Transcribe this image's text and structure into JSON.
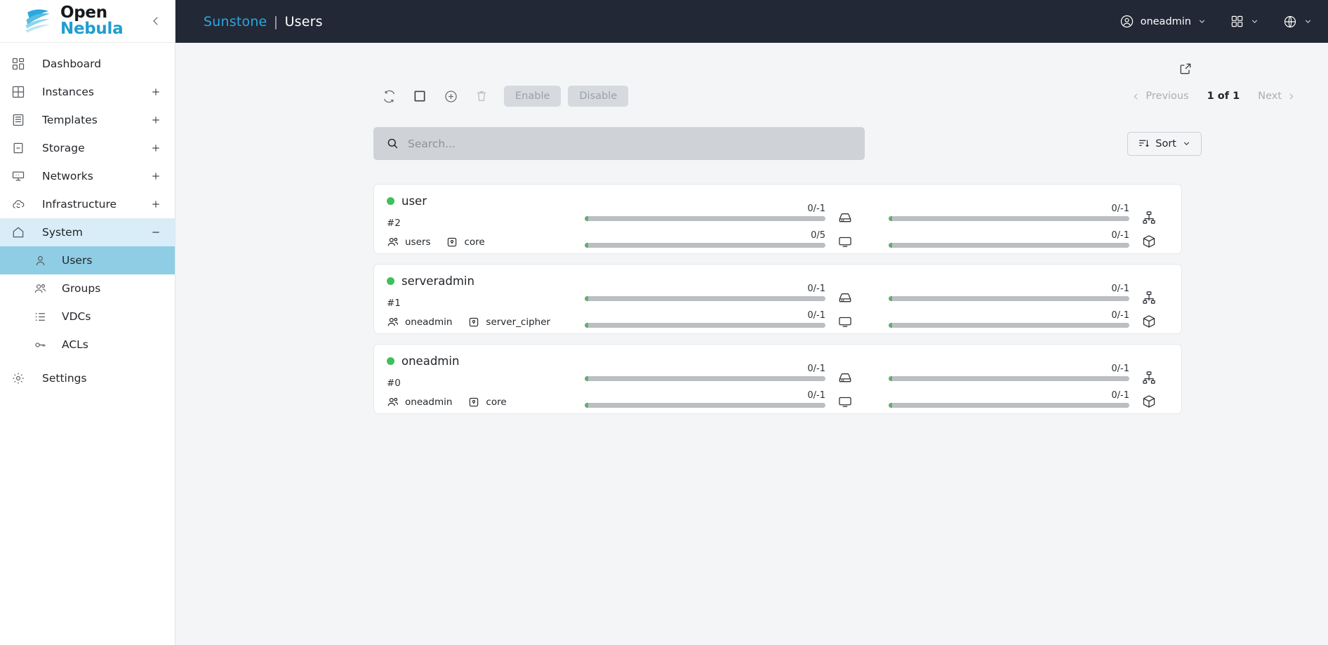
{
  "brand": {
    "line1": "Open",
    "line2": "Nebula",
    "logo_color": "#1f9ed0",
    "collapse_icon": "chevron-left-icon"
  },
  "header": {
    "app_name": "Sunstone",
    "separator": "|",
    "section": "Users",
    "accent_color": "#2aa8e0",
    "background": "#232836",
    "user": {
      "label": "oneadmin",
      "icon": "user-circle-icon"
    },
    "apps": {
      "icon": "grid-apps-icon"
    },
    "language": {
      "icon": "globe-icon"
    }
  },
  "sidebar": {
    "items": [
      {
        "label": "Dashboard",
        "icon": "dashboard-icon",
        "has_plus": false
      },
      {
        "label": "Instances",
        "icon": "instances-grid-icon",
        "has_plus": true
      },
      {
        "label": "Templates",
        "icon": "templates-drawer-icon",
        "has_plus": true
      },
      {
        "label": "Storage",
        "icon": "storage-icon",
        "has_plus": true
      },
      {
        "label": "Networks",
        "icon": "network-monitor-icon",
        "has_plus": true
      },
      {
        "label": "Infrastructure",
        "icon": "cloud-infrastructure-icon",
        "has_plus": true
      },
      {
        "label": "System",
        "icon": "home-icon",
        "has_plus": true,
        "expanded": true,
        "collapse_sign": "−"
      }
    ],
    "system_children": [
      {
        "label": "Users",
        "icon": "user-icon",
        "active": true
      },
      {
        "label": "Groups",
        "icon": "users-group-icon",
        "active": false
      },
      {
        "label": "VDCs",
        "icon": "list-icon",
        "active": false
      },
      {
        "label": "ACLs",
        "icon": "key-icon",
        "active": false
      }
    ],
    "settings": {
      "label": "Settings",
      "icon": "gear-icon"
    },
    "active_bg": "#8ecde4",
    "expanded_bg": "#d8edf7"
  },
  "toolbar": {
    "refresh_icon": "refresh-icon",
    "select_all_icon": "checkbox-square-icon",
    "add_icon": "plus-circle-icon",
    "delete_icon": "trash-icon",
    "enable_label": "Enable",
    "disable_label": "Disable",
    "export_icon": "external-link-icon"
  },
  "pagination": {
    "previous_label": "Previous",
    "next_label": "Next",
    "count_label": "1 of 1",
    "prev_icon": "chevron-left-icon",
    "next_icon": "chevron-right-icon"
  },
  "search": {
    "placeholder": "Search...",
    "value": "",
    "icon": "search-icon"
  },
  "sort": {
    "label": "Sort",
    "icon": "sort-icon",
    "chevron": "chevron-down-icon"
  },
  "quota_icons": {
    "datastore": "datastore-icon",
    "vm": "vm-monitor-icon",
    "network": "network-nodes-icon",
    "image": "image-box-icon"
  },
  "users": [
    {
      "name": "user",
      "id_label": "#2",
      "state_color": "#3fc158",
      "group": "users",
      "group_icon": "users-group-icon",
      "auth": "core",
      "auth_icon": "lock-icon",
      "quotas": {
        "datastore": "0/-1",
        "vm": "0/5",
        "network": "0/-1",
        "image": "0/-1"
      }
    },
    {
      "name": "serveradmin",
      "id_label": "#1",
      "state_color": "#3fc158",
      "group": "oneadmin",
      "group_icon": "users-group-icon",
      "auth": "server_cipher",
      "auth_icon": "lock-icon",
      "quotas": {
        "datastore": "0/-1",
        "vm": "0/-1",
        "network": "0/-1",
        "image": "0/-1"
      }
    },
    {
      "name": "oneadmin",
      "id_label": "#0",
      "state_color": "#3fc158",
      "group": "oneadmin",
      "group_icon": "users-group-icon",
      "auth": "core",
      "auth_icon": "lock-icon",
      "quotas": {
        "datastore": "0/-1",
        "vm": "0/-1",
        "network": "0/-1",
        "image": "0/-1"
      }
    }
  ]
}
